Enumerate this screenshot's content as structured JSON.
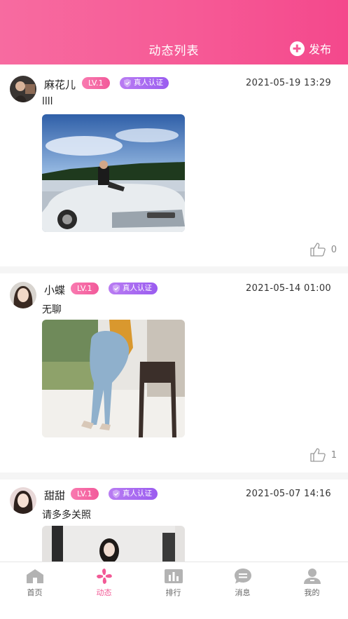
{
  "header": {
    "title": "动态列表",
    "publish_label": "发布"
  },
  "posts": [
    {
      "username": "麻花儿",
      "level": "LV.1",
      "verified": "真人认证",
      "time": "2021-05-19 13:29",
      "text": "llll",
      "likes": "0"
    },
    {
      "username": "小蝶",
      "level": "LV.1",
      "verified": "真人认证",
      "time": "2021-05-14 01:00",
      "text": "无聊",
      "likes": "1"
    },
    {
      "username": "甜甜",
      "level": "LV.1",
      "verified": "真人认证",
      "time": "2021-05-07 14:16",
      "text": "请多多关照",
      "likes": ""
    }
  ],
  "tabs": [
    {
      "label": "首页",
      "icon": "home-icon"
    },
    {
      "label": "动态",
      "icon": "pinwheel-icon"
    },
    {
      "label": "排行",
      "icon": "ranking-icon"
    },
    {
      "label": "消息",
      "icon": "message-icon"
    },
    {
      "label": "我的",
      "icon": "profile-icon"
    }
  ],
  "colors": {
    "accent": "#f25a96",
    "level_badge": "#f25a9a",
    "verify_badge": "#9a5cf0"
  }
}
